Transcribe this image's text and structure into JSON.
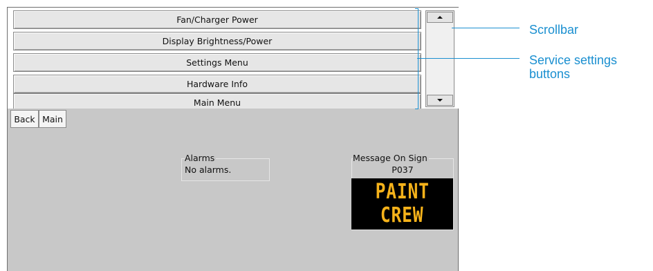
{
  "menu": {
    "items": [
      {
        "label": "Fan/Charger Power"
      },
      {
        "label": "Display Brightness/Power"
      },
      {
        "label": "Settings Menu"
      },
      {
        "label": "Hardware Info"
      },
      {
        "label": "Main Menu"
      }
    ]
  },
  "scrollbar": {
    "up_icon": "arrow-up-icon",
    "down_icon": "arrow-down-icon"
  },
  "nav": {
    "back_label": "Back",
    "main_label": "Main"
  },
  "alarms": {
    "title": "Alarms",
    "text": "No alarms."
  },
  "sign": {
    "title": "Message On Sign",
    "code": "P037",
    "line1": "PAINT",
    "line2": "CREW",
    "color": "#f5b21a"
  },
  "annotations": {
    "scrollbar_label": "Scrollbar",
    "service_label_line1": "Service settings",
    "service_label_line2": "buttons",
    "color": "#1a8fd0"
  }
}
